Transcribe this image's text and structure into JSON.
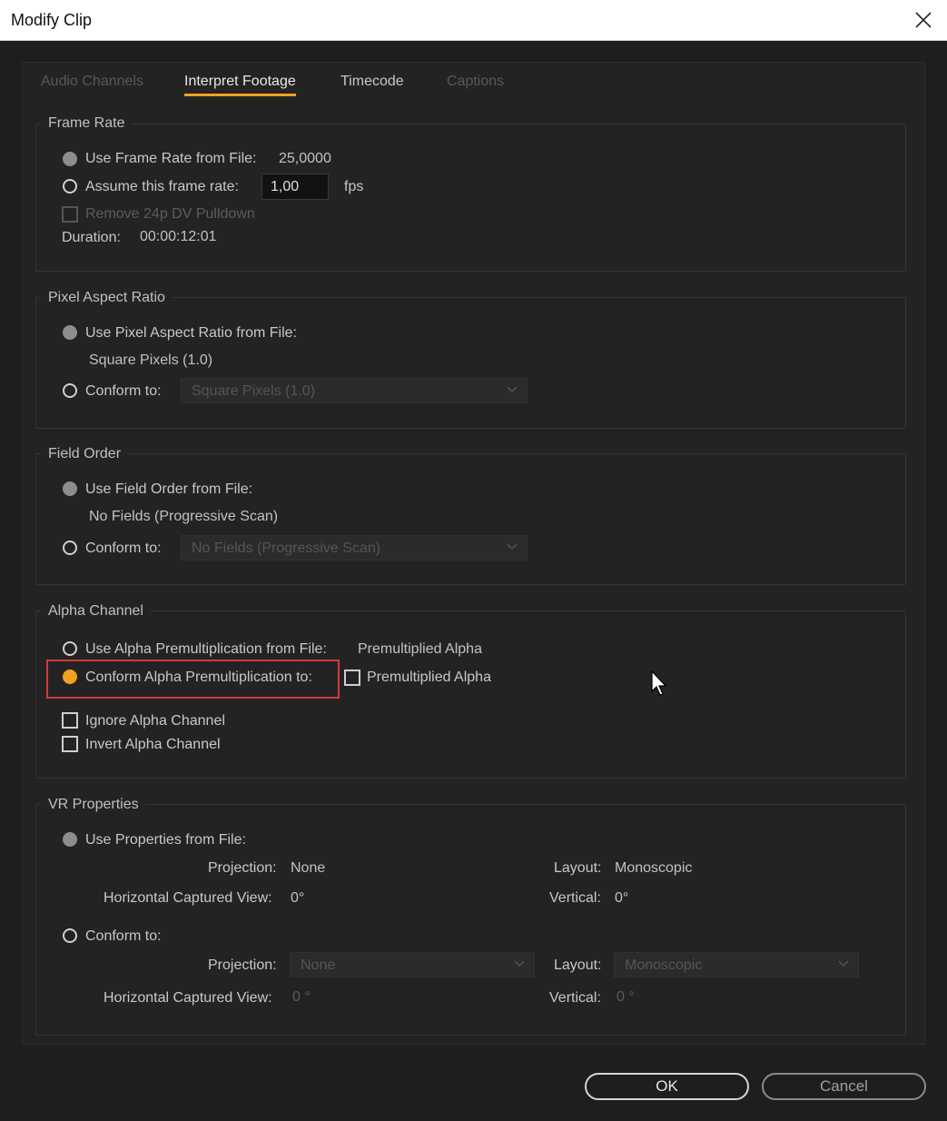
{
  "window": {
    "title": "Modify Clip"
  },
  "tabs": [
    "Audio Channels",
    "Interpret Footage",
    "Timecode",
    "Captions"
  ],
  "frame_rate": {
    "title": "Frame Rate",
    "use_from_file_label": "Use Frame Rate from File:",
    "file_rate_value": "25,0000",
    "assume_label": "Assume this frame rate:",
    "assume_value": "1,00",
    "fps_unit": "fps",
    "remove_pulldown_label": "Remove 24p DV Pulldown",
    "duration_label": "Duration:",
    "duration_value": "00:00:12:01"
  },
  "pixel_aspect": {
    "title": "Pixel Aspect Ratio",
    "use_from_file_label": "Use Pixel Aspect Ratio from File:",
    "file_value": "Square Pixels (1.0)",
    "conform_label": "Conform to:",
    "conform_value": "Square Pixels (1.0)"
  },
  "field_order": {
    "title": "Field Order",
    "use_from_file_label": "Use Field Order from File:",
    "file_value": "No Fields (Progressive Scan)",
    "conform_label": "Conform to:",
    "conform_value": "No Fields (Progressive Scan)"
  },
  "alpha": {
    "title": "Alpha Channel",
    "use_from_file_label": "Use Alpha Premultiplication from File:",
    "file_value": "Premultiplied Alpha",
    "conform_label": "Conform Alpha Premultiplication to:",
    "premult_check_label": "Premultiplied Alpha",
    "ignore_label": "Ignore Alpha Channel",
    "invert_label": "Invert Alpha Channel"
  },
  "vr": {
    "title": "VR Properties",
    "use_from_file_label": "Use Properties from File:",
    "projection_label": "Projection:",
    "projection_value": "None",
    "layout_label": "Layout:",
    "layout_value": "Monoscopic",
    "hcv_label": "Horizontal Captured View:",
    "hcv_value": "0°",
    "vertical_label": "Vertical:",
    "vertical_value": "0°",
    "conform_label": "Conform to:",
    "conform_projection_value": "None",
    "conform_layout_value": "Monoscopic",
    "conform_hcv_value": "0 °",
    "conform_vertical_value": "0 °"
  },
  "buttons": {
    "ok": "OK",
    "cancel": "Cancel"
  },
  "colors": {
    "accent": "#f0a21e",
    "highlight_box": "#d33a3a"
  }
}
